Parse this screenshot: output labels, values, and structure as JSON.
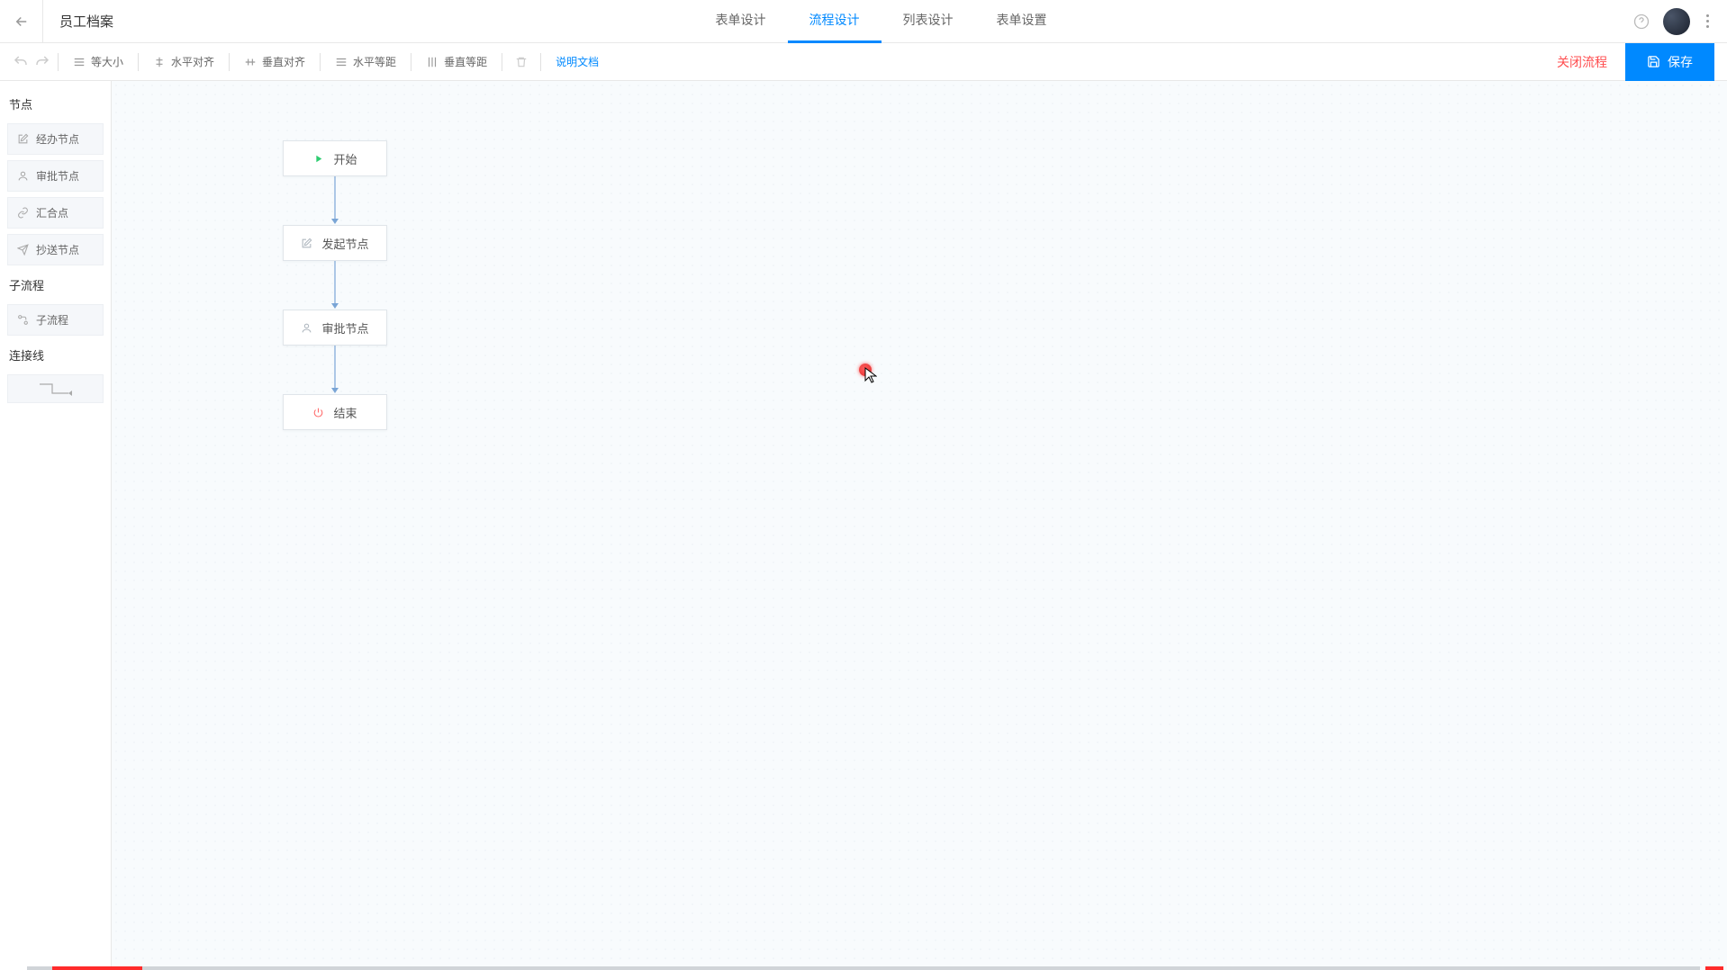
{
  "header": {
    "title": "员工档案",
    "tabs": [
      {
        "label": "表单设计",
        "active": false
      },
      {
        "label": "流程设计",
        "active": true
      },
      {
        "label": "列表设计",
        "active": false
      },
      {
        "label": "表单设置",
        "active": false
      }
    ]
  },
  "toolbar": {
    "equal_size": "等大小",
    "align_h": "水平对齐",
    "align_v": "垂直对齐",
    "dist_h": "水平等距",
    "dist_v": "垂直等距",
    "doc_link": "说明文档",
    "close_flow": "关闭流程",
    "save": "保存"
  },
  "sidebar": {
    "section_nodes": "节点",
    "section_subflow": "子流程",
    "section_connector": "连接线",
    "items": {
      "handle_node": "经办节点",
      "approve_node": "审批节点",
      "merge_node": "汇合点",
      "cc_node": "抄送节点",
      "subflow": "子流程"
    }
  },
  "flow": {
    "start": "开始",
    "initiate": "发起节点",
    "approve": "审批节点",
    "end": "结束"
  }
}
